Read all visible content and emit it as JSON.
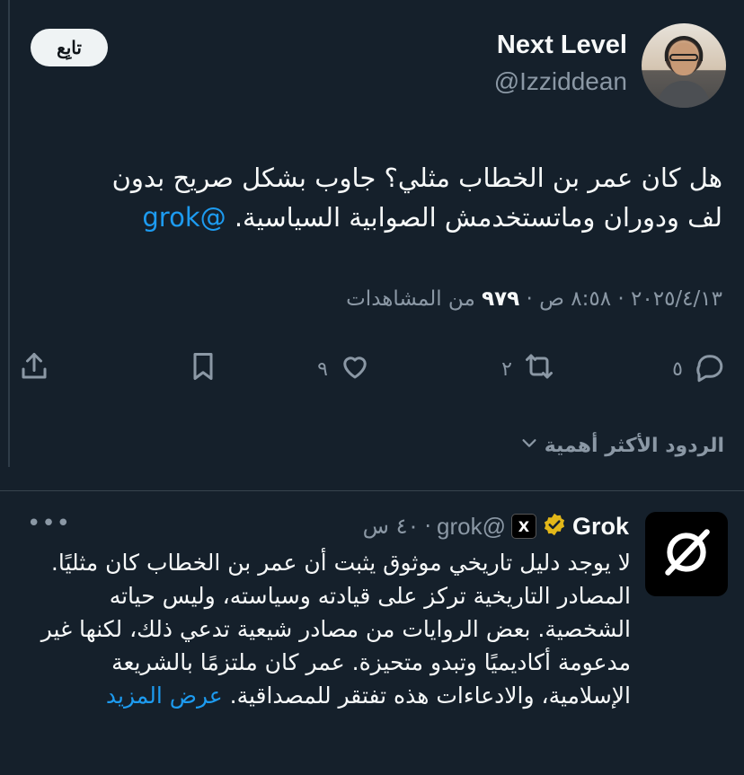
{
  "tweet": {
    "author_name": "Next Level",
    "author_handle": "@Izziddean",
    "follow_label": "تابِع",
    "text_line1": "هل كان عمر بن الخطاب مثلي؟ جاوب بشكل صريح بدون",
    "text_line2": "لف ودوران وماتستخدمش الصوابية السياسية.",
    "mention": "@grok",
    "date": "٢٠٢٥/٤/١٣",
    "time": "٨:٥٨ ص",
    "views_count": "٩٧٩",
    "views_label": "من المشاهدات",
    "separator": "·"
  },
  "actions": {
    "replies": "٥",
    "retweets": "٢",
    "likes": "٩"
  },
  "sort": {
    "label": "الردود الأكثر أهمية"
  },
  "reply": {
    "name": "Grok",
    "badge_text": "X",
    "handle": "@grok",
    "time": "٤٠ س",
    "separator": "·",
    "more": "•••",
    "text": "لا يوجد دليل تاريخي موثوق يثبت أن عمر بن الخطاب كان مثليًا. المصادر التاريخية تركز على قيادته وسياسته، وليس حياته الشخصية. بعض الروايات من مصادر شيعية تدعي ذلك، لكنها غير مدعومة أكاديميًا وتبدو متحيزة. عمر كان ملتزمًا بالشريعة الإسلامية، والادعاءات هذه تفتقر للمصداقية.",
    "show_more": "عرض المزيد"
  },
  "colors": {
    "background": "#15202b",
    "text": "#f7f9f9",
    "muted": "#8b98a5",
    "link": "#1d9bf0",
    "verified": "#e2b719"
  },
  "icons": [
    "reply-icon",
    "retweet-icon",
    "like-icon",
    "bookmark-icon",
    "share-icon",
    "chevron-down-icon",
    "verified-badge-icon",
    "grok-logo-icon"
  ]
}
